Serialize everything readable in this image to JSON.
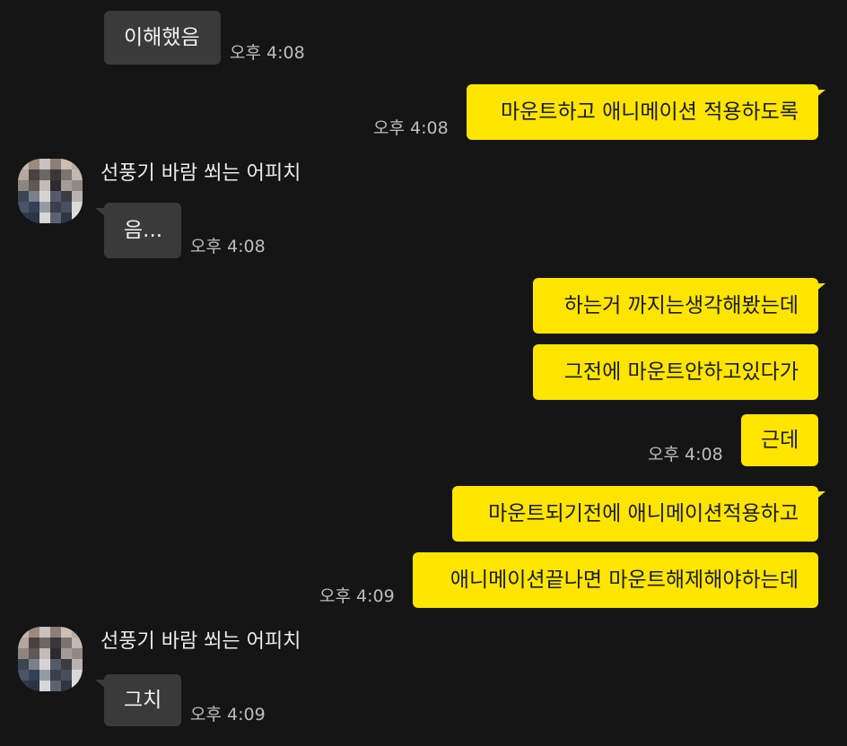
{
  "colors": {
    "background": "#151515",
    "incoming_bubble": "#3a3a3a",
    "outgoing_bubble": "#fee500",
    "timestamp": "#bdbdbd"
  },
  "sender_name": "선풍기 바람 쐬는 어피치",
  "messages": [
    {
      "text": "이해했음",
      "time": "오후 4:08"
    },
    {
      "text": "마운트하고 애니메이션 적용하도록",
      "time": "오후 4:08"
    },
    {
      "text": "음...",
      "time": "오후 4:08"
    },
    {
      "text": "하는거 까지는생각해봤는데"
    },
    {
      "text": "그전에 마운트안하고있다가"
    },
    {
      "text": "근데",
      "time": "오후 4:08"
    },
    {
      "text": "마운트되기전에 애니메이션적용하고"
    },
    {
      "text": "애니메이션끝나면 마운트해제해야하는데",
      "time": "오후 4:09"
    },
    {
      "text": "그치",
      "time": "오후 4:09"
    }
  ]
}
